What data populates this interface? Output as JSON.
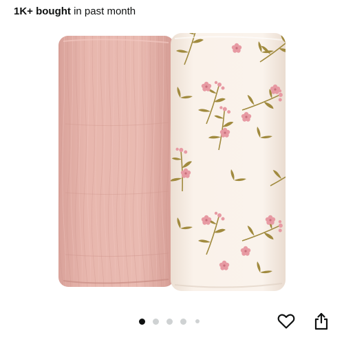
{
  "social_proof": {
    "bold_text": "1K+ bought",
    "rest_text": "in past month"
  },
  "product_image": {
    "description_icon": "swaddle-blankets-image"
  },
  "carousel": {
    "total_dots": 5,
    "active_index": 0
  },
  "actions": {
    "favorite_icon": "heart-icon",
    "share_icon": "share-icon"
  },
  "colors": {
    "text": "#0f1111",
    "pink_blanket": "#e7b3ab",
    "floral_background": "#f8efe7",
    "flower_pink": "#e79aa3",
    "stem_olive": "#a08a3e",
    "dot_active": "#0f1111",
    "dot_inactive": "#cfd2d3"
  }
}
